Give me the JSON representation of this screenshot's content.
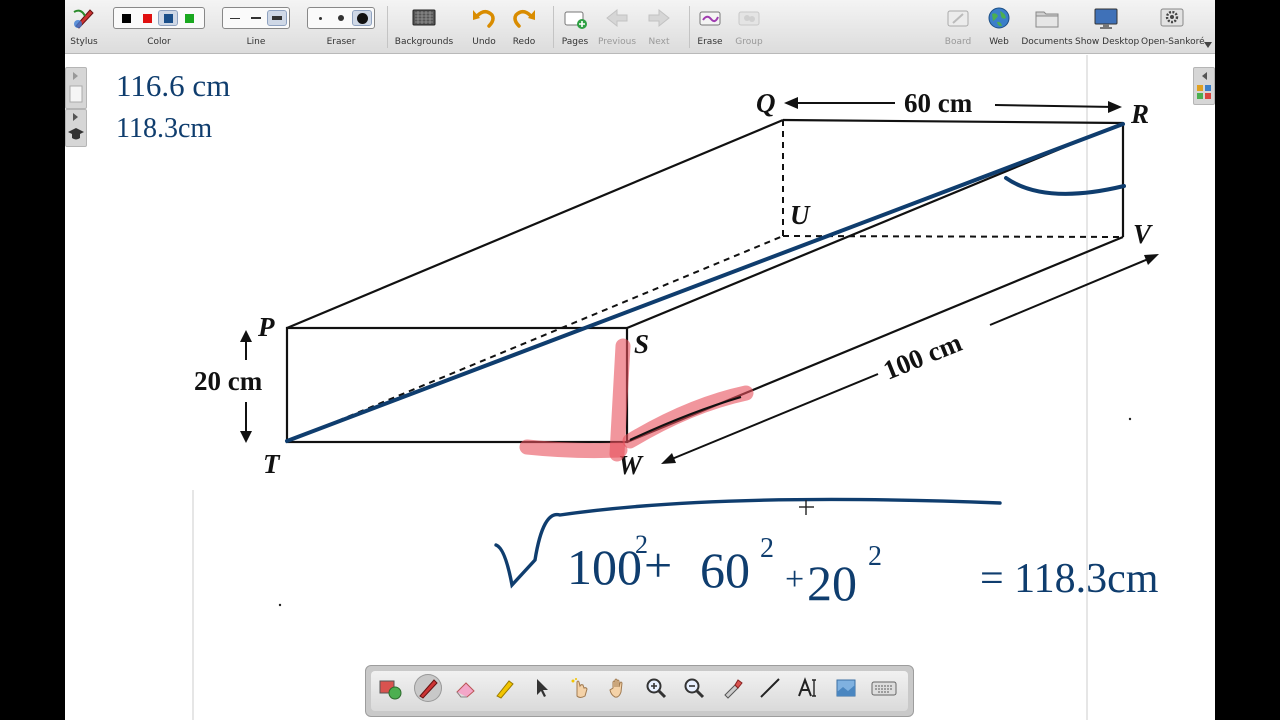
{
  "toolbar": {
    "stylus": "Stylus",
    "color": "Color",
    "line": "Line",
    "eraser": "Eraser",
    "backgrounds": "Backgrounds",
    "undo": "Undo",
    "redo": "Redo",
    "pages": "Pages",
    "previous": "Previous",
    "next": "Next",
    "erase": "Erase",
    "group": "Group",
    "board": "Board",
    "web": "Web",
    "documents": "Documents",
    "show_desktop": "Show Desktop",
    "open_sankore": "Open-Sankoré"
  },
  "colors": {
    "palette": [
      "#000000",
      "#e01010",
      "#1a4f8a",
      "#1aa820"
    ],
    "ink_blue": "#0f3d6e",
    "highlight_red": "#e8505b"
  },
  "diagram": {
    "vertices": {
      "P": "P",
      "Q": "Q",
      "R": "R",
      "S": "S",
      "T": "T",
      "U": "U",
      "V": "V",
      "W": "W"
    },
    "dim_width": "60 cm",
    "dim_height": "20 cm",
    "dim_length": "100 cm"
  },
  "notes": {
    "line1": "116.6 cm",
    "line2": "118.3cm",
    "formula_a": "100",
    "formula_b": "60",
    "formula_c": "20",
    "exp": "2",
    "plus": "+",
    "result": "= 118.3cm"
  },
  "dock_tools": [
    "select-tool",
    "pen-tool",
    "eraser-tool",
    "highlighter-tool",
    "pointer-tool",
    "laser-pointer-tool",
    "hand-tool",
    "zoom-in-tool",
    "zoom-out-tool",
    "capture-tool",
    "line-tool",
    "text-tool",
    "screen-capture-tool",
    "keyboard-tool"
  ]
}
